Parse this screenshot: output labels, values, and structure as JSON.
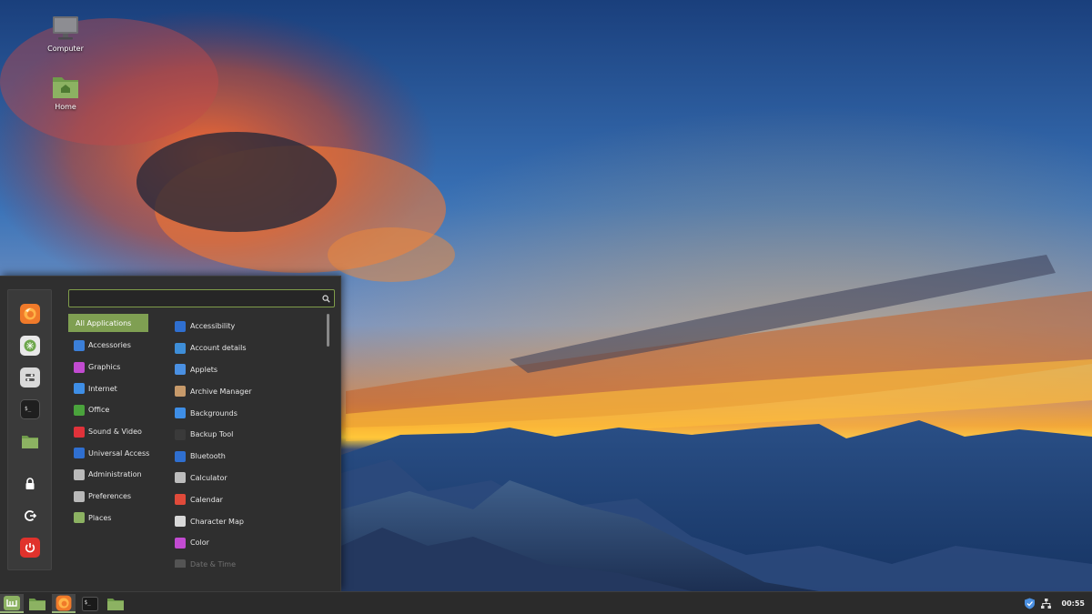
{
  "desktop": {
    "icons": [
      {
        "label": "Computer",
        "icon": "computer-icon"
      },
      {
        "label": "Home",
        "icon": "home-folder-icon"
      }
    ]
  },
  "menu": {
    "search": {
      "value": "",
      "placeholder": ""
    },
    "favorites": [
      {
        "icon": "firefox-icon",
        "color": "#f07a2a"
      },
      {
        "icon": "software-manager-icon",
        "color": "#6da64b"
      },
      {
        "icon": "settings-icon",
        "color": "#d9d9d9"
      },
      {
        "icon": "terminal-icon",
        "color": "#1f1f1f"
      },
      {
        "icon": "files-icon",
        "color": "#8cb262"
      },
      {
        "icon": "lock-screen-icon",
        "color": "#ffffff"
      },
      {
        "icon": "logout-icon",
        "color": "#ffffff"
      },
      {
        "icon": "shutdown-icon",
        "color": "#e0322c"
      }
    ],
    "categories": [
      {
        "label": "All Applications",
        "selected": true
      },
      {
        "label": "Accessories",
        "icon": "accessories-icon",
        "color": "#3b7fd8"
      },
      {
        "label": "Graphics",
        "icon": "graphics-icon",
        "color": "#c24bd1"
      },
      {
        "label": "Internet",
        "icon": "internet-icon",
        "color": "#3e8ee6"
      },
      {
        "label": "Office",
        "icon": "office-icon",
        "color": "#4aa33c"
      },
      {
        "label": "Sound & Video",
        "icon": "sound-video-icon",
        "color": "#e0323a"
      },
      {
        "label": "Universal Access",
        "icon": "universal-access-icon",
        "color": "#2f6fd0"
      },
      {
        "label": "Administration",
        "icon": "administration-icon",
        "color": "#b9b9b9"
      },
      {
        "label": "Preferences",
        "icon": "preferences-icon",
        "color": "#b9b9b9"
      },
      {
        "label": "Places",
        "icon": "places-icon",
        "color": "#8cb262"
      }
    ],
    "apps": [
      {
        "label": "Accessibility",
        "icon": "accessibility-icon",
        "color": "#2f6fd0"
      },
      {
        "label": "Account details",
        "icon": "account-details-icon",
        "color": "#3e8ed8"
      },
      {
        "label": "Applets",
        "icon": "applets-icon",
        "color": "#4a90e2"
      },
      {
        "label": "Archive Manager",
        "icon": "archive-manager-icon",
        "color": "#c79a6a"
      },
      {
        "label": "Backgrounds",
        "icon": "backgrounds-icon",
        "color": "#3e8ee6"
      },
      {
        "label": "Backup Tool",
        "icon": "backup-tool-icon",
        "color": "#3a3a3a"
      },
      {
        "label": "Bluetooth",
        "icon": "bluetooth-icon",
        "color": "#2f6fd0"
      },
      {
        "label": "Calculator",
        "icon": "calculator-icon",
        "color": "#bdbdbd"
      },
      {
        "label": "Calendar",
        "icon": "calendar-icon",
        "color": "#e04a3a"
      },
      {
        "label": "Character Map",
        "icon": "character-map-icon",
        "color": "#d8d8d8"
      },
      {
        "label": "Color",
        "icon": "color-icon",
        "color": "#c24bd1"
      },
      {
        "label": "Date & Time",
        "icon": "date-time-icon",
        "color": "#9a9a9a"
      }
    ]
  },
  "taskbar": {
    "items": [
      {
        "icon": "menu-icon",
        "active": true
      },
      {
        "icon": "show-desktop-icon",
        "active": false
      },
      {
        "icon": "firefox-icon",
        "active": true
      },
      {
        "icon": "terminal-icon",
        "active": false
      },
      {
        "icon": "files-icon",
        "active": false
      }
    ],
    "tray": [
      {
        "icon": "update-shield-icon"
      },
      {
        "icon": "network-icon"
      }
    ],
    "clock": "00:55"
  },
  "colors": {
    "accent": "#7f9f52",
    "menu_bg": "#2f2f2f",
    "panel_bg": "#2b2b2b"
  }
}
